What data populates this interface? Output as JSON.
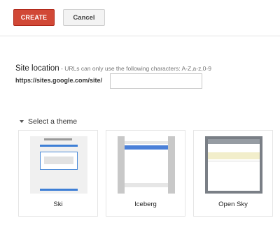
{
  "toolbar": {
    "create_label": "CREATE",
    "cancel_label": "Cancel"
  },
  "site_location": {
    "label": "Site location",
    "hint": " - URLs can only use the following characters: A-Z,a-z,0-9",
    "url_prefix": "https://sites.google.com/site/",
    "input_value": "",
    "input_placeholder": ""
  },
  "themes": {
    "header": "Select a theme",
    "items": [
      {
        "label": "Ski"
      },
      {
        "label": "Iceberg"
      },
      {
        "label": "Open Sky"
      }
    ]
  },
  "colors": {
    "create_button": "#d14836",
    "accent_blue": "#3e7fd6"
  }
}
